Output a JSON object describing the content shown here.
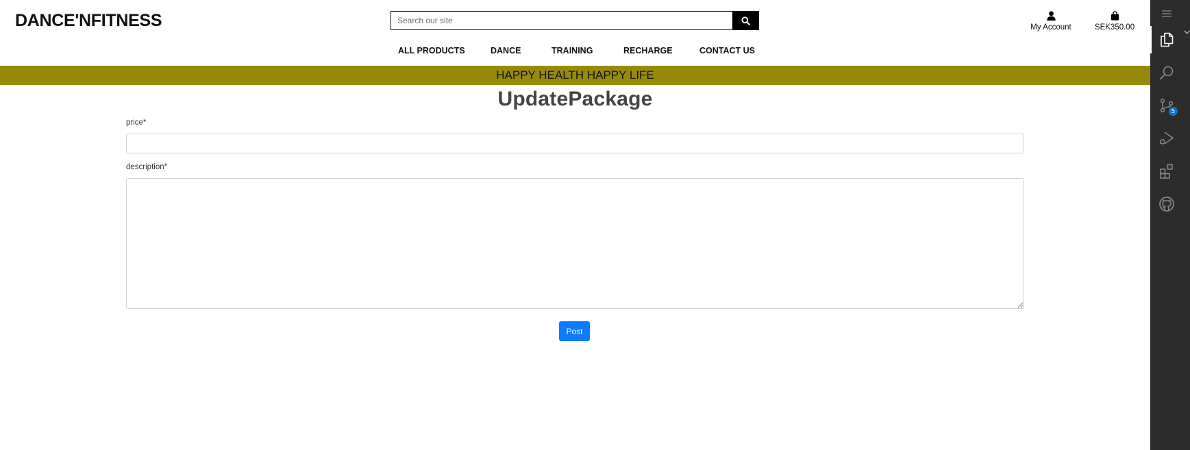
{
  "header": {
    "logo": "DANCE'NFITNESS",
    "search_placeholder": "Search our site",
    "account_label": "My Account",
    "bag_total": "SEK350.00"
  },
  "nav": {
    "items": [
      "ALL PRODUCTS",
      "DANCE",
      "TRAINING",
      "RECHARGE",
      "CONTACT US"
    ]
  },
  "banner": {
    "text": "HAPPY HEALTH HAPPY LIFE",
    "color": "#978a0b"
  },
  "form": {
    "title": "UpdatePackage",
    "price_label": "price*",
    "price_value": "",
    "description_label": "description*",
    "description_value": "",
    "submit_label": "Post",
    "submit_color": "#0d7bff"
  },
  "activity_bar": {
    "background": "#2c2c2c",
    "items": [
      {
        "icon": "menu-icon"
      },
      {
        "icon": "explorer-files-icon",
        "active": true
      },
      {
        "icon": "search-icon"
      },
      {
        "icon": "source-control-icon",
        "badge": "5"
      },
      {
        "icon": "run-debug-icon"
      },
      {
        "icon": "extensions-icon"
      },
      {
        "icon": "github-icon"
      }
    ]
  }
}
